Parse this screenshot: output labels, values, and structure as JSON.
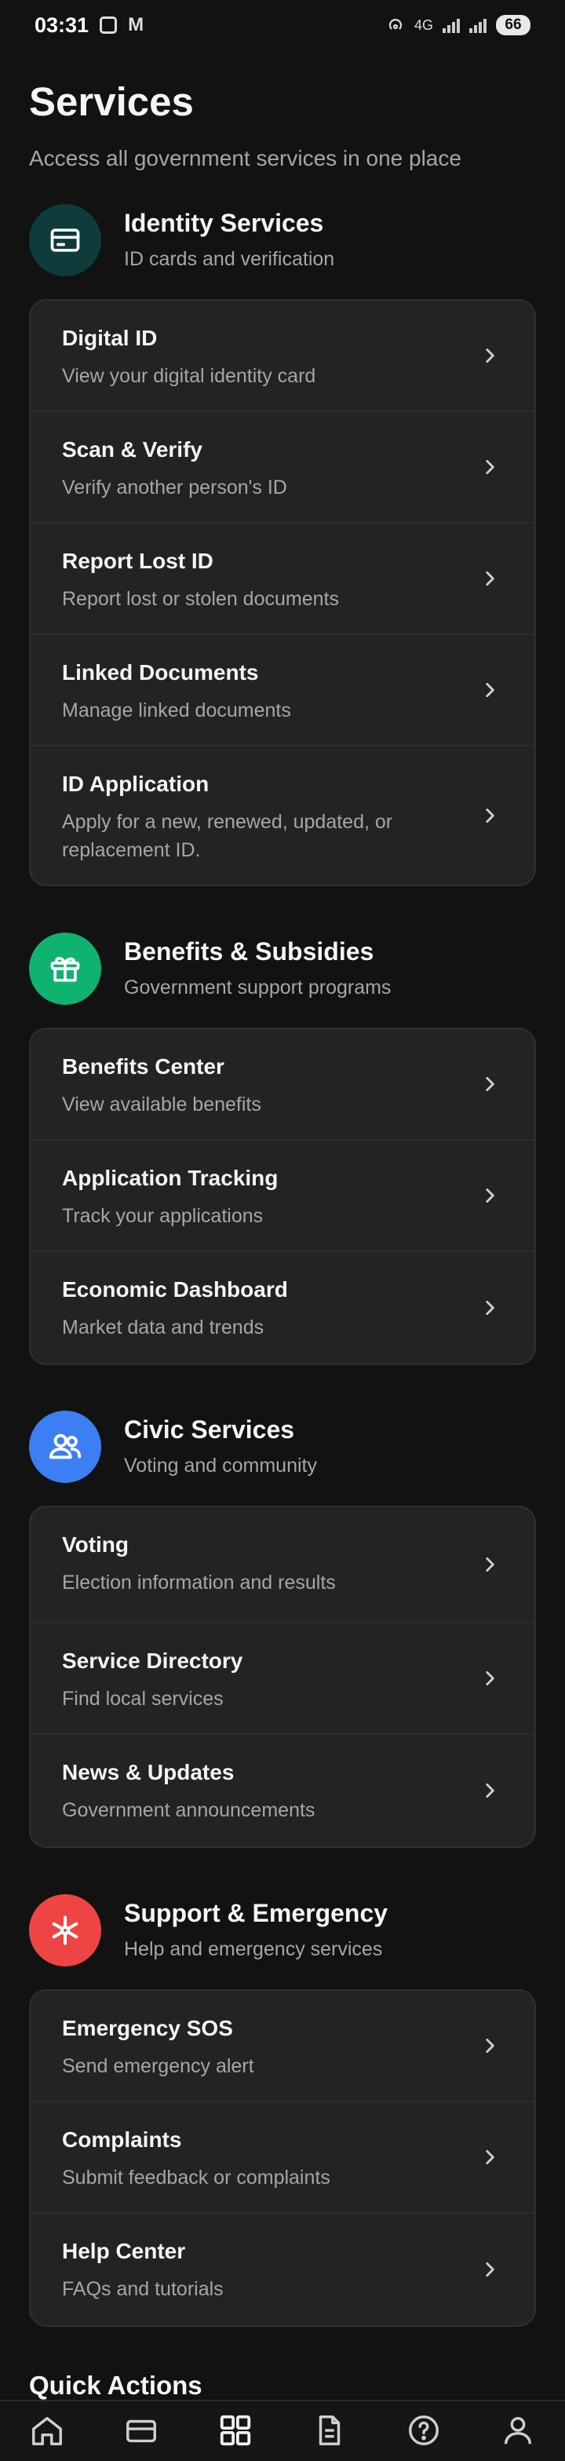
{
  "status_bar": {
    "time": "03:31",
    "network": "4G",
    "battery": "66"
  },
  "page": {
    "title": "Services",
    "subtitle": "Access all government services in one place"
  },
  "sections": [
    {
      "title": "Identity Services",
      "subtitle": "ID cards and verification",
      "icon": "id-card-icon",
      "icon_bg": "#0f3b3c",
      "icon_color": "#ffffff",
      "items": [
        {
          "title": "Digital ID",
          "desc": "View your digital identity card"
        },
        {
          "title": "Scan & Verify",
          "desc": "Verify another person's ID"
        },
        {
          "title": "Report Lost ID",
          "desc": "Report lost or stolen documents"
        },
        {
          "title": "Linked Documents",
          "desc": "Manage linked documents"
        },
        {
          "title": "ID Application",
          "desc": "Apply for a new, renewed, updated, or replacement ID."
        }
      ]
    },
    {
      "title": "Benefits & Subsidies",
      "subtitle": "Government support programs",
      "icon": "gift-icon",
      "icon_bg": "#10b26f",
      "icon_color": "#ffffff",
      "items": [
        {
          "title": "Benefits Center",
          "desc": "View available benefits"
        },
        {
          "title": "Application Tracking",
          "desc": "Track your applications"
        },
        {
          "title": "Economic Dashboard",
          "desc": "Market data and trends"
        }
      ]
    },
    {
      "title": "Civic Services",
      "subtitle": "Voting and community",
      "icon": "users-icon",
      "icon_bg": "#3b7ff2",
      "icon_color": "#ffffff",
      "items": [
        {
          "title": "Voting",
          "desc": "Election information and results"
        },
        {
          "title": "Service Directory",
          "desc": "Find local services"
        },
        {
          "title": "News & Updates",
          "desc": "Government announcements"
        }
      ]
    },
    {
      "title": "Support & Emergency",
      "subtitle": "Help and emergency services",
      "icon": "asterisk-icon",
      "icon_bg": "#ef4444",
      "icon_color": "#ffffff",
      "items": [
        {
          "title": "Emergency SOS",
          "desc": "Send emergency alert"
        },
        {
          "title": "Complaints",
          "desc": "Submit feedback or complaints"
        },
        {
          "title": "Help Center",
          "desc": "FAQs and tutorials"
        }
      ]
    }
  ],
  "quick_actions": {
    "title": "Quick Actions"
  },
  "bottom_nav": [
    "home-icon",
    "card-icon",
    "grid-icon",
    "document-icon",
    "help-icon",
    "profile-icon"
  ]
}
